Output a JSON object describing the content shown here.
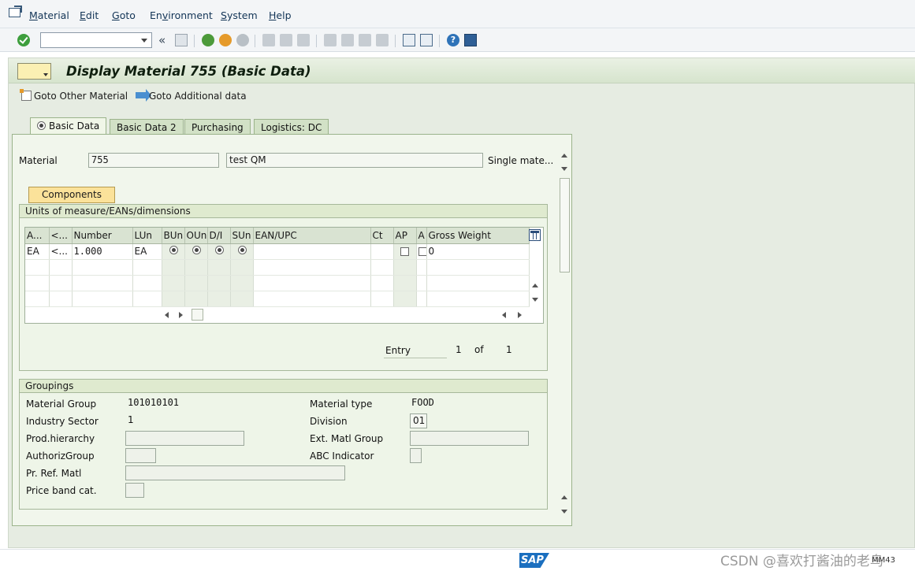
{
  "menu": [
    "Material",
    "Edit",
    "Goto",
    "Environment",
    "System",
    "Help"
  ],
  "menu_underline": [
    "M",
    "E",
    "G",
    "v",
    "S",
    "H"
  ],
  "page_title": "Display Material 755 (Basic Data)",
  "app_toolbar": {
    "goto_other": "Goto Other Material",
    "goto_additional": "Goto Additional data"
  },
  "tabs": [
    "Basic Data",
    "Basic Data 2",
    "Purchasing",
    "Logistics: DC"
  ],
  "material": {
    "label": "Material",
    "number": "755",
    "description": "test QM",
    "type_text": "Single mate..."
  },
  "components_button": "Components",
  "uom_group": {
    "title": "Units of measure/EANs/dimensions",
    "columns": [
      "A...",
      "<...",
      "Number",
      "LUn",
      "BUn",
      "OUn",
      "D/I",
      "SUn",
      "EAN/UPC",
      "Ct",
      "AP",
      "A",
      "Gross Weight"
    ],
    "rows": [
      {
        "a": "EA",
        "b": "<...",
        "number": "1.000",
        "lun": "EA",
        "gross": "0"
      }
    ],
    "entry_label": "Entry",
    "entry_current": "1",
    "entry_of": "of",
    "entry_total": "1"
  },
  "groupings": {
    "title": "Groupings",
    "material_group_label": "Material Group",
    "material_group": "101010101",
    "material_type_label": "Material type",
    "material_type": "FOOD",
    "industry_sector_label": "Industry Sector",
    "industry_sector": "1",
    "division_label": "Division",
    "division": "01",
    "prod_hierarchy_label": "Prod.hierarchy",
    "ext_matl_group_label": "Ext. Matl Group",
    "authoriz_group_label": "AuthorizGroup",
    "abc_indicator_label": "ABC Indicator",
    "pr_ref_matl_label": "Pr. Ref. Matl",
    "price_band_label": "Price band cat."
  },
  "status": {
    "sap_logo": "SAP",
    "watermark": "CSDN @喜欢打酱油的老鸟",
    "tcode": "MM43"
  }
}
